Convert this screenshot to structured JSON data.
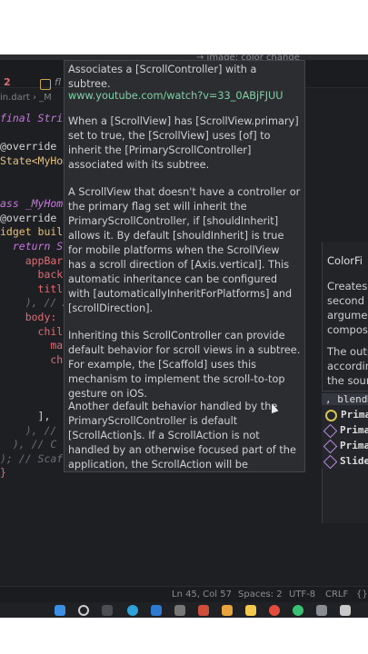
{
  "topbar": {
    "hint": "→  image: color change"
  },
  "tabs": {
    "count": "2",
    "file": "fl"
  },
  "breadcrumb": "in.dart  ›  _M",
  "code_lines": [
    "final Strin",
    "",
    "@override",
    "State<MyHom",
    "",
    "",
    "ass _MyHome",
    "@override",
    "idget buil",
    "  return Sc",
    "    appBar:",
    "      backg",
    "      title",
    "    ), // A",
    "    body: C",
    "      child",
    "        mai",
    "        chi",
    "          C",
    "",
    "",
    "      ],",
    "    ), //",
    "  ), // C",
    "); // Scaffold",
    "}"
  ],
  "doc": {
    "close": "×",
    "header": "Associates a [ScrollController] with a subtree.",
    "link": "www.youtube.com/watch?v=33_0ABjFJUU",
    "para1": "When a [ScrollView] has [ScrollView.primary] set to true, the [ScrollView] uses [of] to inherit the [PrimaryScrollController] associated with its subtree.",
    "para2": "A ScrollView that doesn't have a controller or the primary flag set will inherit the PrimaryScrollController, if [shouldInherit] allows it. By default [shouldInherit] is true for mobile platforms when the ScrollView has a scroll direction of [Axis.vertical]. This automatic inheritance can be configured with [automaticallyInheritForPlatforms] and [scrollDirection].",
    "para3": "Inheriting this ScrollController can provide default behavior for scroll views in a subtree. For example, the [Scaffold] uses this mechanism to implement the scroll-to-top gesture on iOS.",
    "para4": "Another default behavior handled by the PrimaryScrollController is default [ScrollAction]s. If a ScrollAction is not handled by an otherwise focused part of the application, the ScrollAction will be evaluated using the"
  },
  "side_panel": {
    "title": "ColorFi",
    "line1": "Creates a",
    "line2": "second a",
    "line3": "argumen",
    "line4": "composi",
    "line5": "The outp",
    "line6": "accordin",
    "line7": "the sour"
  },
  "suggestions": {
    "input": "blendM",
    "items": [
      "Prima",
      "Prima",
      "Prima",
      "Slide"
    ]
  },
  "statusbar": {
    "position": "Ln 45, Col 57",
    "spaces": "Spaces: 2",
    "encoding": "UTF-8",
    "eol": "CRLF",
    "braces": "{}"
  },
  "colors": {
    "keyword": "#c678dd",
    "type": "#e5c07b",
    "comment": "#6a6f78",
    "link": "#7fd3a6"
  }
}
